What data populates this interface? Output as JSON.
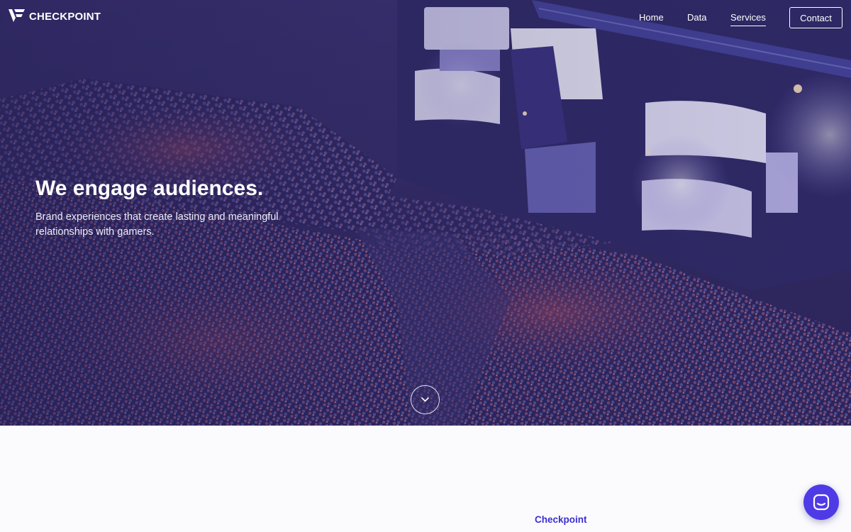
{
  "brand": {
    "name": "CHECKPOINT",
    "logo_icon": "checkpoint-logo-icon"
  },
  "nav": {
    "links": [
      {
        "label": "Home"
      },
      {
        "label": "Data"
      },
      {
        "label": "Services",
        "active": true
      }
    ],
    "contact_label": "Contact"
  },
  "hero": {
    "title": "We engage audiences.",
    "subtitle": "Brand experiences that create lasting and meaningful relationships with gamers.",
    "scroll_icon": "chevron-down-icon",
    "overlay_color": "#2a2456"
  },
  "section": {
    "label": "Checkpoint"
  },
  "chat": {
    "icon": "chat-icon",
    "color": "#4e3be6"
  },
  "colors": {
    "accent": "#3b2fd1",
    "hero_tint": "#2a2456",
    "page_background": "#fbfbfe"
  }
}
